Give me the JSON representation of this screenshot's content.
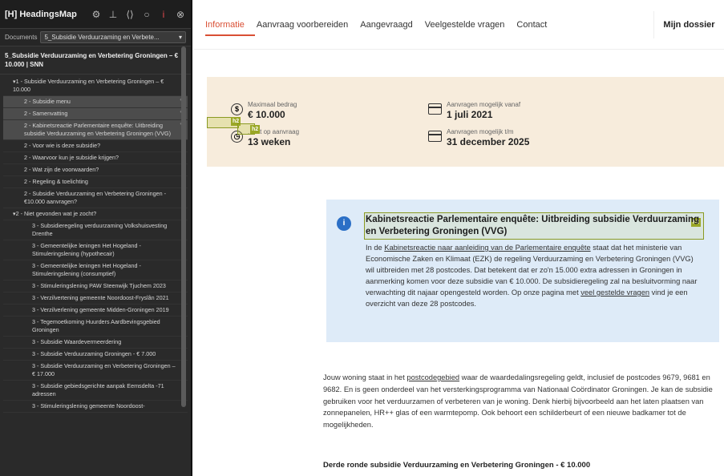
{
  "sidebar": {
    "title": "HeadingsMap",
    "logo_prefix": "[H]",
    "icons": [
      "settings-icon",
      "pin-icon",
      "brackets-icon",
      "circle-icon",
      "info-icon",
      "close-icon"
    ],
    "documents_label": "Documents",
    "document_select": "5_Subsidie Verduurzaming en Verbete...",
    "doc_title": "5_Subsidie Verduurzaming en Verbetering Groningen – € 10.000 | SNN",
    "tree": [
      {
        "level": 1,
        "text": "▾1 - Subsidie Verduurzaming en Verbetering Groningen – € 10.000"
      },
      {
        "level": 2,
        "text": "2 - Subsidie menu",
        "edit": true,
        "highlight": true
      },
      {
        "level": 2,
        "text": "2 - Samenvatting",
        "edit": true,
        "highlight": true
      },
      {
        "level": 2,
        "text": "2 - Kabinetsreactie Parlementaire enquête: Uitbreiding subsidie Verduurzaming en Verbetering Groningen (VVG)",
        "edit": true,
        "highlight": true
      },
      {
        "level": 2,
        "text": "2 - Voor wie is deze subsidie?"
      },
      {
        "level": 2,
        "text": "2 - Waarvoor kun je subsidie krijgen?"
      },
      {
        "level": 2,
        "text": "2 - Wat zijn de voorwaarden?"
      },
      {
        "level": 2,
        "text": "2 - Regeling & toelichting"
      },
      {
        "level": 2,
        "text": "2 - Subsidie Verduurzaming en Verbetering Groningen - €10.000 aanvragen?"
      },
      {
        "level": 1,
        "text": "▾2 - Niet gevonden wat je zocht?"
      },
      {
        "level": 3,
        "text": "3 - Subsidieregeling verduurzaming Volkshuisvesting Drenthe"
      },
      {
        "level": 3,
        "text": "3 - Gemeentelijke leningen Het Hogeland - Stimuleringslening (hypothecair)"
      },
      {
        "level": 3,
        "text": "3 - Gemeentelijke leningen Het Hogeland - Stimuleringslening (consumptief)"
      },
      {
        "level": 3,
        "text": "3 - Stimuleringslening PAW Steenwijk Tjuchem 2023"
      },
      {
        "level": 3,
        "text": "3 - Verzilvertening gemeente Noordoost-Fryslân 2021"
      },
      {
        "level": 3,
        "text": "3 - Verzilverlening gemeente Midden-Groningen 2019"
      },
      {
        "level": 3,
        "text": "3 - Tegemoetkoming Huurders Aardbevingsgebied Groningen"
      },
      {
        "level": 3,
        "text": "3 - Subsidie Waardevermeerdering"
      },
      {
        "level": 3,
        "text": "3 - Subsidie Verduurzaming Groningen - € 7.000"
      },
      {
        "level": 3,
        "text": "3 - Subsidie Verduurzaming en Verbetering Groningen – € 17.000"
      },
      {
        "level": 3,
        "text": "3 - Subsidie gebiedsgerichte aanpak Eemsdelta -71 adressen"
      },
      {
        "level": 3,
        "text": "3 - Stimuleringslening gemeente Noordoost-"
      }
    ]
  },
  "nav": {
    "items": [
      "Informatie",
      "Aanvraag voorbereiden",
      "Aangevraagd",
      "Veelgestelde vragen",
      "Contact"
    ],
    "dossier": "Mijn dossier"
  },
  "facts": {
    "max_label": "Maximaal bedrag",
    "max_value": "€ 10.000",
    "from_label": "Aanvragen mogelijk vanaf",
    "from_value": "1 juli 2021",
    "decision_label": "...ust op aanvraag",
    "decision_value": "13 weken",
    "until_label": "Aanvragen mogelijk t/m",
    "until_value": "31 december 2025"
  },
  "overlay_tags": {
    "h2_a": "h2",
    "h2_b": "h2",
    "h2_c": "h2"
  },
  "notice": {
    "icon": "i",
    "title": "Kabinetsreactie Parlementaire enquête: Uitbreiding subsidie Verduurzaming en Verbetering Groningen (VVG)",
    "body_1": "In de ",
    "body_link1": "Kabinetsreactie naar aanleiding van de Parlementaire enquête",
    "body_2": " staat dat het ministerie van Economische Zaken en Klimaat (EZK) de regeling Verduurzaming en Verbetering Groningen (VVG) wil uitbreiden met 28 postcodes. Dat betekent dat er zo'n 15.000 extra adressen in Groningen in aanmerking komen voor deze subsidie van € 10.000. De subsidieregeling zal na besluitvorming naar verwachting dit najaar opengesteld worden. Op onze pagina met ",
    "body_link2": "veel gestelde vragen",
    "body_3": " vind je een overzicht van deze 28 postcodes."
  },
  "content": {
    "p1_a": "Jouw woning staat in het ",
    "p1_link": "postcodegebied",
    "p1_b": " waar de waardedalingsregeling geldt, inclusief de postcodes 9679, 9681 en 9682. En is geen onderdeel van het versterkingsprogramma van Nationaal Coördinator Groningen. Je kan de subsidie gebruiken voor het verduurzamen of verbeteren van je woning. Denk hierbij bijvoorbeeld aan het laten plaatsen van zonnepanelen, HR++ glas of een warmtepomp. Ook behoort een schilderbeurt of een nieuwe badkamer tot de mogelijkheden.",
    "heading": "Derde ronde subsidie Verduurzaming en Verbetering Groningen - € 10.000"
  },
  "colors": {
    "accent": "#d94f34",
    "sidebar_bg": "#2a2a2a",
    "band_bg": "#f7ecdc",
    "notice_bg": "#deebf8",
    "overlay": "#9aa726"
  }
}
